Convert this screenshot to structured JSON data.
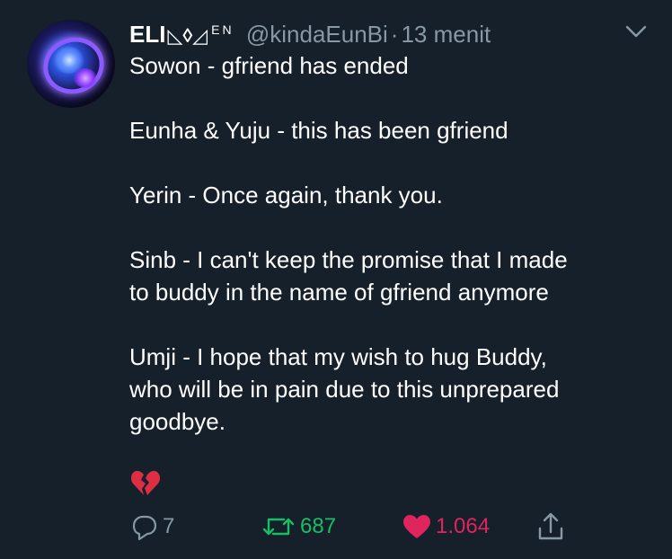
{
  "tweet": {
    "author": {
      "display_name": "ELI",
      "name_symbols": "◺◊◿",
      "name_sup": "EN",
      "handle": "@kindaEunBi",
      "separator": "·",
      "time": "13 menit"
    },
    "lines": {
      "l1": "Sowon - gfriend has ended",
      "l2": "Eunha & Yuju - this has been gfriend",
      "l3": "Yerin - Once again, thank you.",
      "l4a": "Sinb - I can't keep the promise that I made",
      "l4b": "to buddy in the name of gfriend anymore",
      "l5a": "Umji - I hope that my wish to hug Buddy,",
      "l5b": "who will be in pain due to this unprepared",
      "l5c": "goodbye."
    },
    "emoji": "broken-heart",
    "actions": {
      "replies": "7",
      "retweets": "687",
      "likes": "1.064"
    }
  },
  "colors": {
    "background": "#15202b",
    "text": "#ffffff",
    "muted": "#8899a6",
    "retweet": "#17bf63",
    "like": "#e0245e"
  },
  "icons": {
    "menu": "chevron-down-icon",
    "reply": "reply-icon",
    "retweet": "retweet-icon",
    "like": "heart-icon",
    "share": "share-icon",
    "emoji": "broken-heart-icon"
  }
}
